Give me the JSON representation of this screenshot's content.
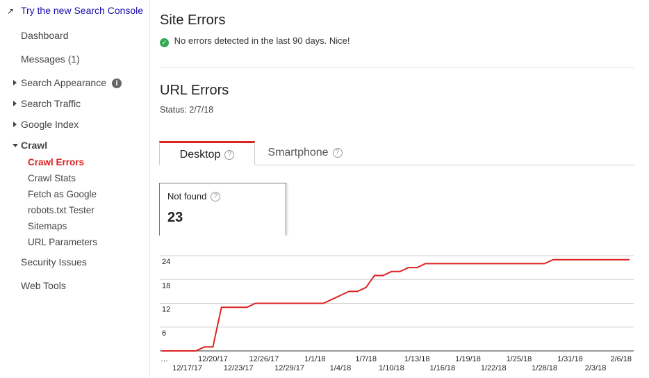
{
  "sidebar": {
    "new_console": "Try the new Search Console",
    "items": [
      {
        "label": "Dashboard"
      },
      {
        "label": "Messages (1)"
      },
      {
        "label": "Search Appearance"
      },
      {
        "label": "Search Traffic"
      },
      {
        "label": "Google Index"
      },
      {
        "label": "Crawl"
      },
      {
        "label": "Security Issues"
      },
      {
        "label": "Web Tools"
      }
    ],
    "crawl_sub": [
      "Crawl Errors",
      "Crawl Stats",
      "Fetch as Google",
      "robots.txt Tester",
      "Sitemaps",
      "URL Parameters"
    ],
    "active_color": "#dd2222"
  },
  "site_errors": {
    "title": "Site Errors",
    "message": "No errors detected in the last 90 days. Nice!"
  },
  "url_errors": {
    "title": "URL Errors",
    "status": "Status: 2/7/18"
  },
  "tabs": [
    {
      "label": "Desktop",
      "active": true
    },
    {
      "label": "Smartphone",
      "active": false
    }
  ],
  "card": {
    "label": "Not found",
    "value": "23"
  },
  "chart_data": {
    "type": "line",
    "ylim": [
      0,
      24
    ],
    "yticks": [
      6,
      12,
      18,
      24
    ],
    "grid": true,
    "color": "#dd2222",
    "x_start": "12/14/17",
    "x_end": "2/7/18",
    "xticks_row1": [
      "…",
      "12/20/17",
      "12/26/17",
      "1/1/18",
      "1/7/18",
      "1/13/18",
      "1/19/18",
      "1/25/18",
      "1/31/18",
      "2/6/18"
    ],
    "xticks_row2": [
      "12/17/17",
      "12/23/17",
      "12/29/17",
      "1/4/18",
      "1/10/18",
      "1/16/18",
      "1/22/18",
      "1/28/18",
      "2/3/18"
    ],
    "values": [
      0,
      0,
      0,
      0,
      0,
      1,
      1,
      11,
      11,
      11,
      11,
      12,
      12,
      12,
      12,
      12,
      12,
      12,
      12,
      12,
      13,
      14,
      15,
      15,
      16,
      19,
      19,
      20,
      20,
      21,
      21,
      22,
      22,
      22,
      22,
      22,
      22,
      22,
      22,
      22,
      22,
      22,
      22,
      22,
      22,
      22,
      23,
      23,
      23,
      23,
      23,
      23,
      23,
      23,
      23,
      23
    ]
  }
}
